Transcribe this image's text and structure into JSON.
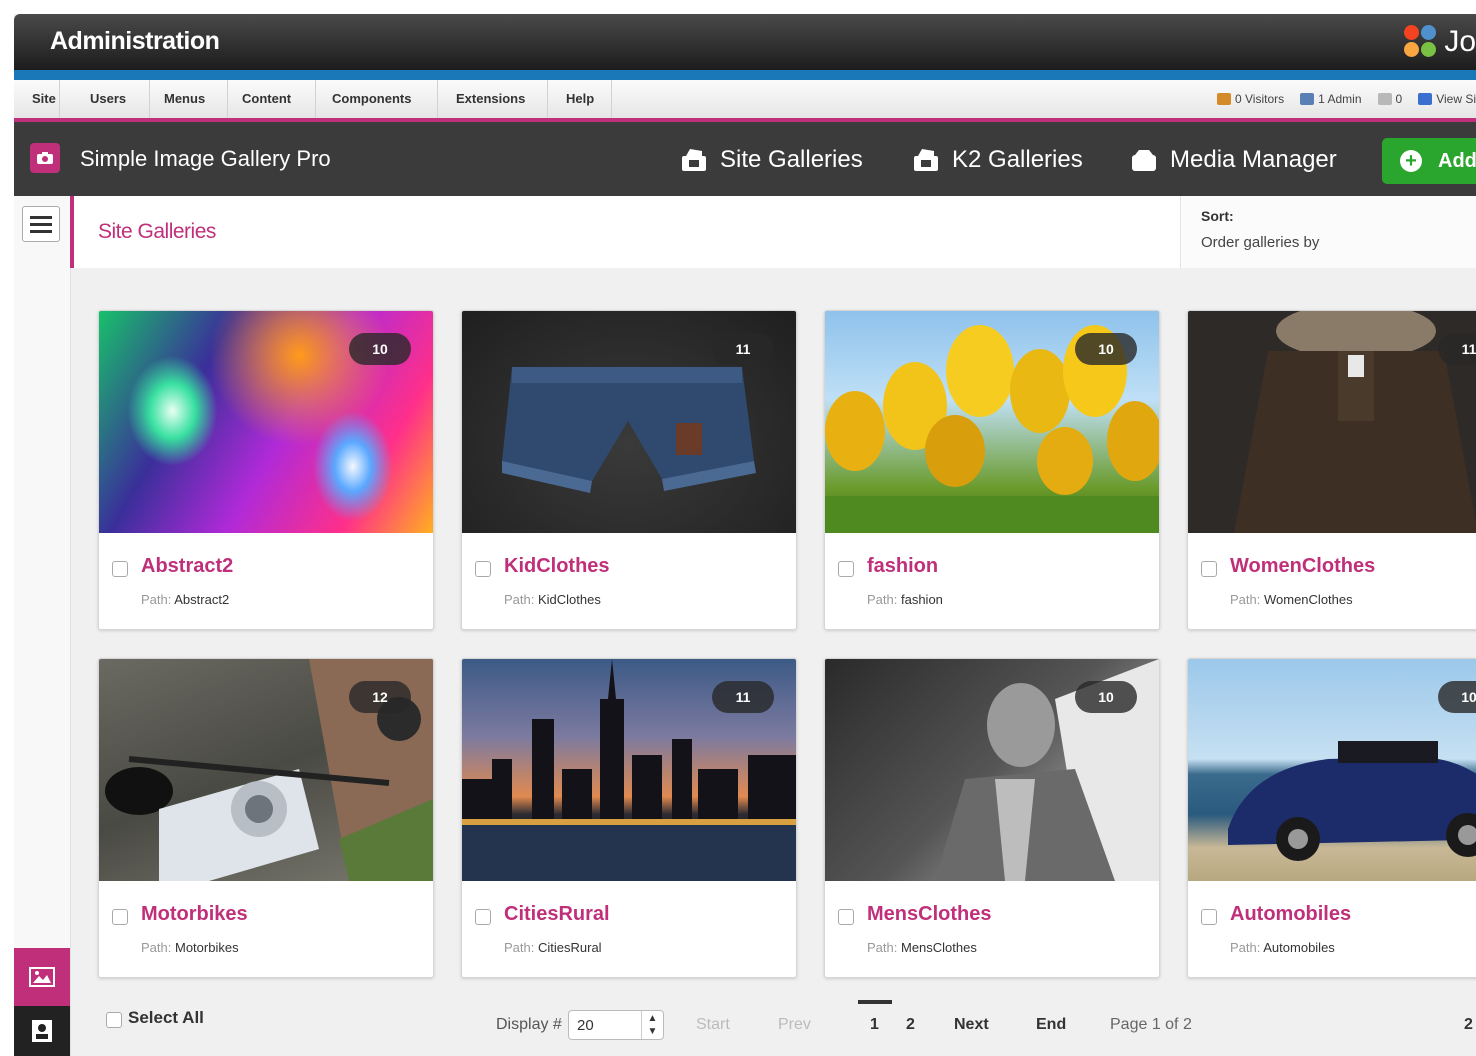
{
  "admin": {
    "title": "Administration",
    "brand_text": "Jo"
  },
  "topmenu": {
    "items": [
      "Site",
      "Users",
      "Menus",
      "Content",
      "Components",
      "Extensions",
      "Help"
    ],
    "status": {
      "visitors": "0 Visitors",
      "admins": "1 Admin",
      "messages": "0",
      "view_site": "View Si"
    }
  },
  "toolbar": {
    "component_title": "Simple Image Gallery Pro",
    "buttons": [
      "Site Galleries",
      "K2 Galleries",
      "Media Manager"
    ],
    "add_label": "Add"
  },
  "page": {
    "title": "Site Galleries",
    "sort_label": "Sort:",
    "sort_value": "Order galleries by"
  },
  "path_prefix": "Path:",
  "galleries": [
    {
      "name": "Abstract2",
      "path": "Abstract2",
      "count": "10"
    },
    {
      "name": "KidClothes",
      "path": "KidClothes",
      "count": "11"
    },
    {
      "name": "fashion",
      "path": "fashion",
      "count": "10"
    },
    {
      "name": "WomenClothes",
      "path": "WomenClothes",
      "count": "11"
    },
    {
      "name": "Motorbikes",
      "path": "Motorbikes",
      "count": "12"
    },
    {
      "name": "CitiesRural",
      "path": "CitiesRural",
      "count": "11"
    },
    {
      "name": "MensClothes",
      "path": "MensClothes",
      "count": "10"
    },
    {
      "name": "Automobiles",
      "path": "Automobiles",
      "count": "10"
    }
  ],
  "footer": {
    "select_all": "Select All",
    "display_label": "Display #",
    "display_value": "20",
    "start": "Start",
    "prev": "Prev",
    "pages": [
      "1",
      "2"
    ],
    "next": "Next",
    "end": "End",
    "page_info": "Page 1 of 2",
    "extra": "2"
  },
  "colors": {
    "accent": "#c0307a",
    "add_green": "#2aa52e",
    "toolbar": "#3b3b3b",
    "blue_strip": "#1a78b8"
  }
}
